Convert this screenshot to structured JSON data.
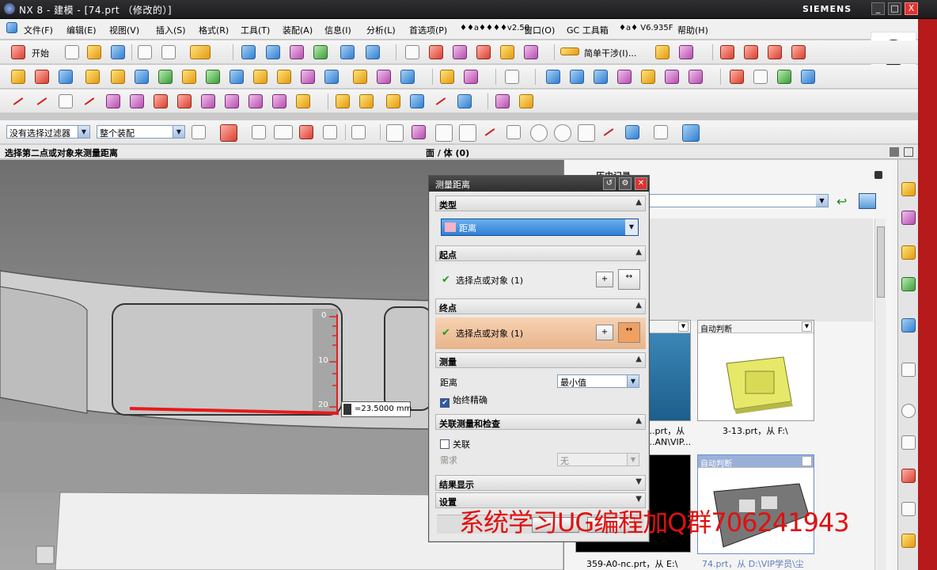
{
  "window": {
    "title": "NX 8 - 建模 - [74.prt （修改的）]",
    "brand": "SIEMENS",
    "minimize": "_",
    "maximize": "□",
    "close": "X"
  },
  "menu": [
    "文件(F)",
    "编辑(E)",
    "视图(V)",
    "插入(S)",
    "格式(R)",
    "工具(T)",
    "装配(A)",
    "信息(I)",
    "分析(L)",
    "首选项(P)",
    "♦♦a♦♦♦♦v2.58",
    "窗口(O)",
    "GC 工具箱",
    "♦a♦ V6.935F",
    "帮助(H)"
  ],
  "toolbar": {
    "start_label": "开始",
    "simple_interference": "简单干涉(I)...",
    "filter": "没有选择过滤器",
    "assembly_scope": "整个装配"
  },
  "status": {
    "prompt": "选择第二点或对象来测量距离",
    "selection": "面 / 体 (0)"
  },
  "viewport": {
    "ruler": [
      "0",
      "10",
      "20"
    ],
    "measure_value": "=23.5000 mm"
  },
  "dialog": {
    "title": "测量距离",
    "type_section": "类型",
    "type_value": "距离",
    "start_section": "起点",
    "start_select": "选择点或对象 (1)",
    "end_section": "终点",
    "end_select": "选择点或对象 (1)",
    "measure_section": "测量",
    "distance_label": "距离",
    "distance_value": "最小值",
    "always_precise": "始终精确",
    "assoc_section": "关联测量和检查",
    "assoc_label": "关联",
    "requirement_label": "需求",
    "requirement_value": "无",
    "result_section": "结果显示",
    "settings_section": "设置"
  },
  "history": {
    "panel_title": "历史记录",
    "thumbs": [
      {
        "header": "",
        "caption1": "...prt，从",
        "caption2": "...AN\\VIP..."
      },
      {
        "header": "自动判断",
        "caption1": "3-13.prt，从 F:\\",
        "caption2": ""
      },
      {
        "header": "",
        "caption1": "359-A0-nc.prt，从 E:\\",
        "caption2": ""
      },
      {
        "header": "自动判断",
        "caption1": "74.prt，从 D:\\VIP学员\\尘",
        "caption2": ""
      }
    ]
  },
  "watermark": "系统学习UG编程加Q群706241943"
}
